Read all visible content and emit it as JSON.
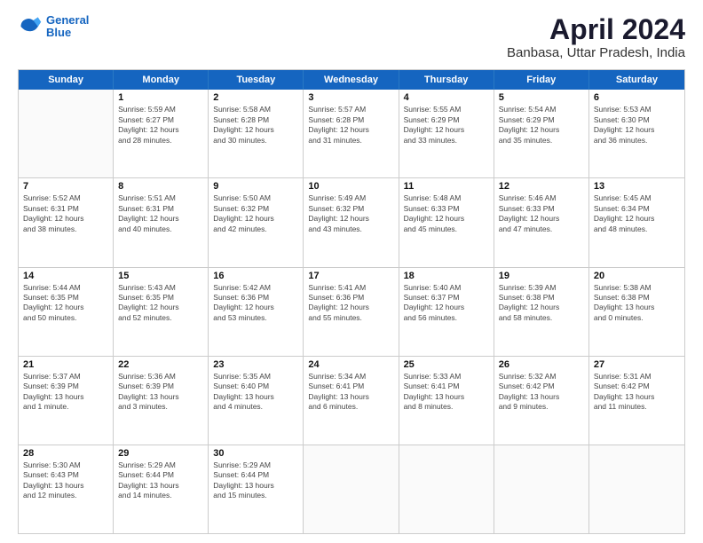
{
  "logo": {
    "line1": "General",
    "line2": "Blue"
  },
  "title": "April 2024",
  "subtitle": "Banbasa, Uttar Pradesh, India",
  "weekdays": [
    "Sunday",
    "Monday",
    "Tuesday",
    "Wednesday",
    "Thursday",
    "Friday",
    "Saturday"
  ],
  "weeks": [
    [
      {
        "day": "",
        "info": ""
      },
      {
        "day": "1",
        "info": "Sunrise: 5:59 AM\nSunset: 6:27 PM\nDaylight: 12 hours\nand 28 minutes."
      },
      {
        "day": "2",
        "info": "Sunrise: 5:58 AM\nSunset: 6:28 PM\nDaylight: 12 hours\nand 30 minutes."
      },
      {
        "day": "3",
        "info": "Sunrise: 5:57 AM\nSunset: 6:28 PM\nDaylight: 12 hours\nand 31 minutes."
      },
      {
        "day": "4",
        "info": "Sunrise: 5:55 AM\nSunset: 6:29 PM\nDaylight: 12 hours\nand 33 minutes."
      },
      {
        "day": "5",
        "info": "Sunrise: 5:54 AM\nSunset: 6:29 PM\nDaylight: 12 hours\nand 35 minutes."
      },
      {
        "day": "6",
        "info": "Sunrise: 5:53 AM\nSunset: 6:30 PM\nDaylight: 12 hours\nand 36 minutes."
      }
    ],
    [
      {
        "day": "7",
        "info": "Sunrise: 5:52 AM\nSunset: 6:31 PM\nDaylight: 12 hours\nand 38 minutes."
      },
      {
        "day": "8",
        "info": "Sunrise: 5:51 AM\nSunset: 6:31 PM\nDaylight: 12 hours\nand 40 minutes."
      },
      {
        "day": "9",
        "info": "Sunrise: 5:50 AM\nSunset: 6:32 PM\nDaylight: 12 hours\nand 42 minutes."
      },
      {
        "day": "10",
        "info": "Sunrise: 5:49 AM\nSunset: 6:32 PM\nDaylight: 12 hours\nand 43 minutes."
      },
      {
        "day": "11",
        "info": "Sunrise: 5:48 AM\nSunset: 6:33 PM\nDaylight: 12 hours\nand 45 minutes."
      },
      {
        "day": "12",
        "info": "Sunrise: 5:46 AM\nSunset: 6:33 PM\nDaylight: 12 hours\nand 47 minutes."
      },
      {
        "day": "13",
        "info": "Sunrise: 5:45 AM\nSunset: 6:34 PM\nDaylight: 12 hours\nand 48 minutes."
      }
    ],
    [
      {
        "day": "14",
        "info": "Sunrise: 5:44 AM\nSunset: 6:35 PM\nDaylight: 12 hours\nand 50 minutes."
      },
      {
        "day": "15",
        "info": "Sunrise: 5:43 AM\nSunset: 6:35 PM\nDaylight: 12 hours\nand 52 minutes."
      },
      {
        "day": "16",
        "info": "Sunrise: 5:42 AM\nSunset: 6:36 PM\nDaylight: 12 hours\nand 53 minutes."
      },
      {
        "day": "17",
        "info": "Sunrise: 5:41 AM\nSunset: 6:36 PM\nDaylight: 12 hours\nand 55 minutes."
      },
      {
        "day": "18",
        "info": "Sunrise: 5:40 AM\nSunset: 6:37 PM\nDaylight: 12 hours\nand 56 minutes."
      },
      {
        "day": "19",
        "info": "Sunrise: 5:39 AM\nSunset: 6:38 PM\nDaylight: 12 hours\nand 58 minutes."
      },
      {
        "day": "20",
        "info": "Sunrise: 5:38 AM\nSunset: 6:38 PM\nDaylight: 13 hours\nand 0 minutes."
      }
    ],
    [
      {
        "day": "21",
        "info": "Sunrise: 5:37 AM\nSunset: 6:39 PM\nDaylight: 13 hours\nand 1 minute."
      },
      {
        "day": "22",
        "info": "Sunrise: 5:36 AM\nSunset: 6:39 PM\nDaylight: 13 hours\nand 3 minutes."
      },
      {
        "day": "23",
        "info": "Sunrise: 5:35 AM\nSunset: 6:40 PM\nDaylight: 13 hours\nand 4 minutes."
      },
      {
        "day": "24",
        "info": "Sunrise: 5:34 AM\nSunset: 6:41 PM\nDaylight: 13 hours\nand 6 minutes."
      },
      {
        "day": "25",
        "info": "Sunrise: 5:33 AM\nSunset: 6:41 PM\nDaylight: 13 hours\nand 8 minutes."
      },
      {
        "day": "26",
        "info": "Sunrise: 5:32 AM\nSunset: 6:42 PM\nDaylight: 13 hours\nand 9 minutes."
      },
      {
        "day": "27",
        "info": "Sunrise: 5:31 AM\nSunset: 6:42 PM\nDaylight: 13 hours\nand 11 minutes."
      }
    ],
    [
      {
        "day": "28",
        "info": "Sunrise: 5:30 AM\nSunset: 6:43 PM\nDaylight: 13 hours\nand 12 minutes."
      },
      {
        "day": "29",
        "info": "Sunrise: 5:29 AM\nSunset: 6:44 PM\nDaylight: 13 hours\nand 14 minutes."
      },
      {
        "day": "30",
        "info": "Sunrise: 5:29 AM\nSunset: 6:44 PM\nDaylight: 13 hours\nand 15 minutes."
      },
      {
        "day": "",
        "info": ""
      },
      {
        "day": "",
        "info": ""
      },
      {
        "day": "",
        "info": ""
      },
      {
        "day": "",
        "info": ""
      }
    ]
  ]
}
